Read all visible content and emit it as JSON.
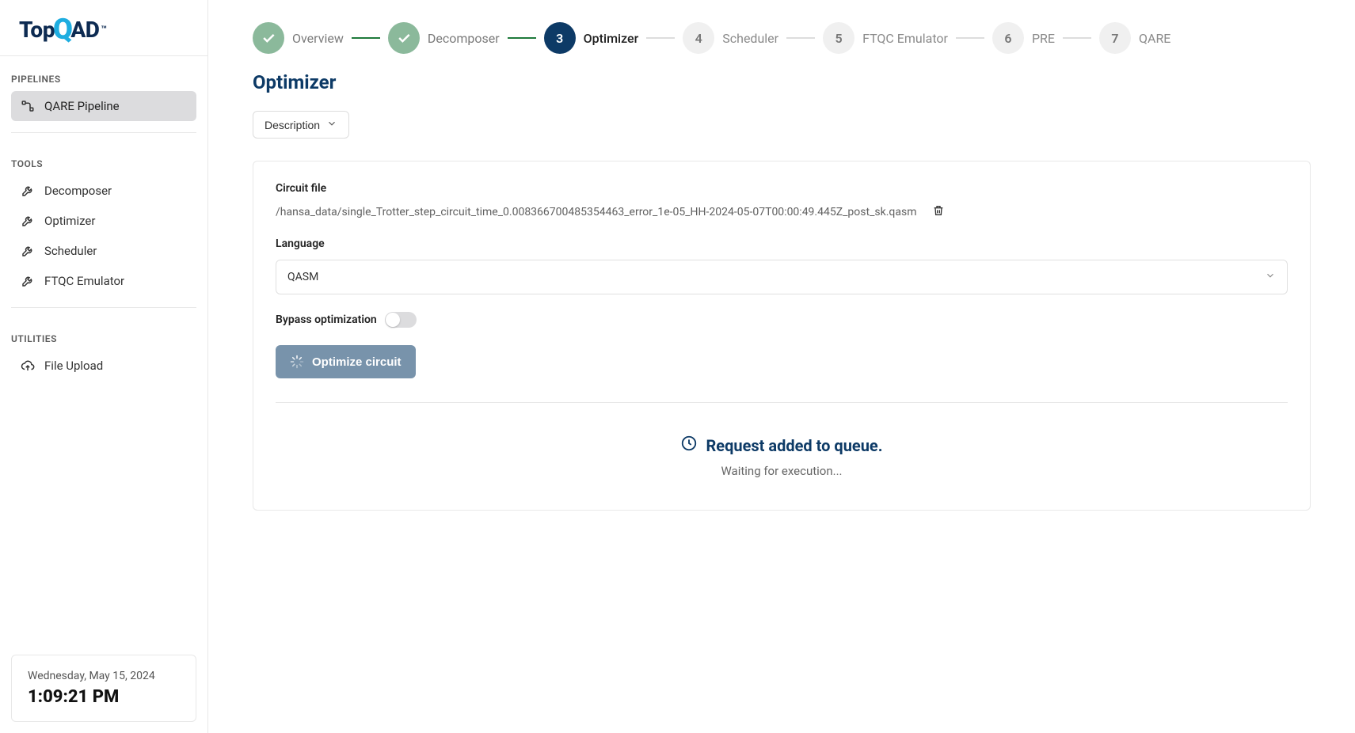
{
  "logo": {
    "top": "Top",
    "q": "Q",
    "ad": "AD",
    "tm": "™"
  },
  "sidebar": {
    "pipelines_header": "PIPELINES",
    "qare_pipeline": "QARE Pipeline",
    "tools_header": "TOOLS",
    "tools": [
      {
        "label": "Decomposer"
      },
      {
        "label": "Optimizer"
      },
      {
        "label": "Scheduler"
      },
      {
        "label": "FTQC Emulator"
      }
    ],
    "utilities_header": "UTILITIES",
    "file_upload": "File Upload"
  },
  "datetime": {
    "date": "Wednesday, May 15, 2024",
    "time": "1:09:21 PM"
  },
  "stepper": [
    {
      "label": "Overview",
      "state": "done"
    },
    {
      "label": "Decomposer",
      "state": "done"
    },
    {
      "num": "3",
      "label": "Optimizer",
      "state": "active"
    },
    {
      "num": "4",
      "label": "Scheduler",
      "state": "pending"
    },
    {
      "num": "5",
      "label": "FTQC Emulator",
      "state": "pending"
    },
    {
      "num": "6",
      "label": "PRE",
      "state": "pending"
    },
    {
      "num": "7",
      "label": "QARE",
      "state": "pending"
    }
  ],
  "page": {
    "title": "Optimizer",
    "description_btn": "Description",
    "circuit_file_label": "Circuit file",
    "circuit_file_path": "/hansa_data/single_Trotter_step_circuit_time_0.008366700485354463_error_1e-05_HH-2024-05-07T00:00:49.445Z_post_sk.qasm",
    "language_label": "Language",
    "language_value": "QASM",
    "bypass_label": "Bypass optimization",
    "optimize_btn": "Optimize circuit",
    "queue_title": "Request added to queue.",
    "queue_sub": "Waiting for execution..."
  }
}
